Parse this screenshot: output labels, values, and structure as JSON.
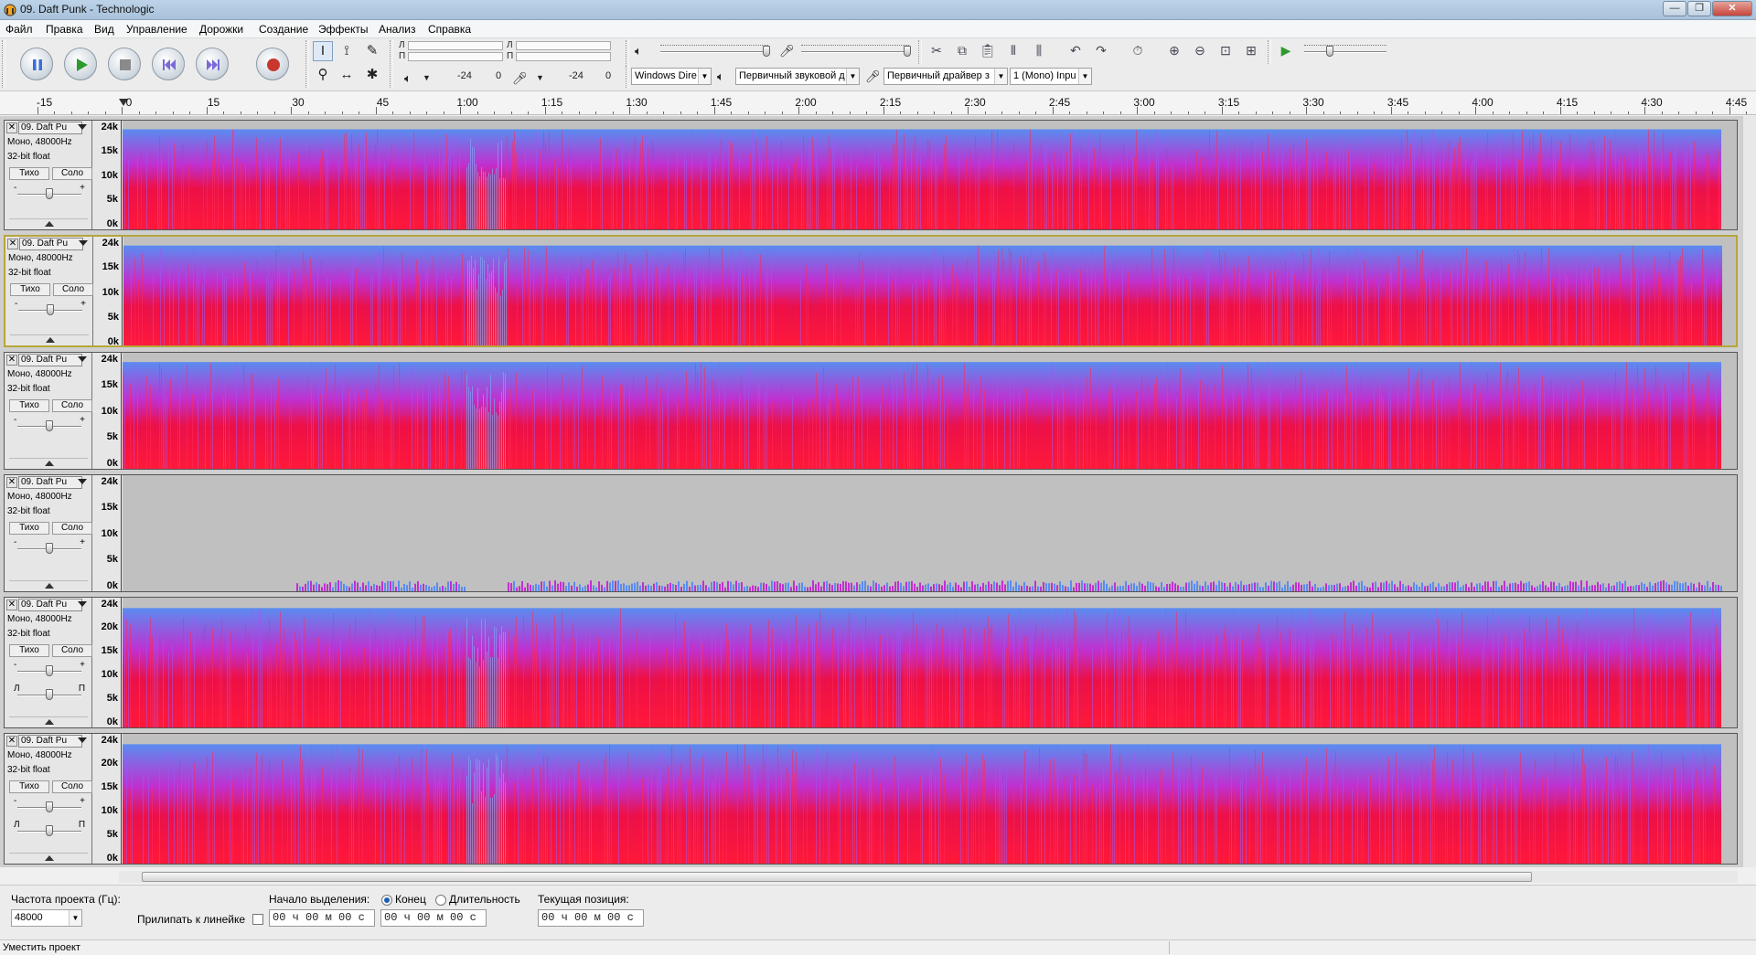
{
  "window": {
    "title": "09. Daft Punk - Technologic"
  },
  "menu": [
    "Файл",
    "Правка",
    "Вид",
    "Управление",
    "Дорожки",
    "Создание",
    "Эффекты",
    "Анализ",
    "Справка"
  ],
  "meters": {
    "left": "Л",
    "right": "П",
    "playback_db": "-24",
    "playback_zero": "0",
    "record_db": "-24",
    "record_zero": "0"
  },
  "devices": {
    "host": "Windows Dire",
    "output": "Первичный звуковой д",
    "input": "Первичный драйвер з",
    "channels": "1 (Mono) Inpu"
  },
  "ruler": [
    "-15",
    "0",
    "15",
    "30",
    "45",
    "1:00",
    "1:15",
    "1:30",
    "1:45",
    "2:00",
    "2:15",
    "2:30",
    "2:45",
    "3:00",
    "3:15",
    "3:30",
    "3:45",
    "4:00",
    "4:15",
    "4:30",
    "4:45"
  ],
  "track_common": {
    "name": "09. Daft Pu",
    "format": "Моно, 48000Hz",
    "bits": "32-bit float",
    "mute": "Тихо",
    "solo": "Соло",
    "gain_minus": "-",
    "gain_plus": "+",
    "pan_left": "Л",
    "pan_right": "П"
  },
  "tracks": [
    {
      "axis": [
        "24k",
        "15k",
        "10k",
        "5k",
        "0k"
      ],
      "spectrum": "full"
    },
    {
      "axis": [
        "24k",
        "15k",
        "10k",
        "5k",
        "0k"
      ],
      "spectrum": "full"
    },
    {
      "axis": [
        "24k",
        "15k",
        "10k",
        "5k",
        "0k"
      ],
      "spectrum": "full"
    },
    {
      "axis": [
        "24k",
        "15k",
        "10k",
        "5k",
        "0k"
      ],
      "spectrum": "sparse"
    },
    {
      "axis": [
        "24k",
        "20k",
        "15k",
        "10k",
        "5k",
        "0k"
      ],
      "spectrum": "full"
    },
    {
      "axis": [
        "24k",
        "20k",
        "15k",
        "10k",
        "5k",
        "0k"
      ],
      "spectrum": "full"
    }
  ],
  "selection": {
    "rate_label": "Частота проекта (Гц):",
    "rate_value": "48000",
    "snap_label": "Прилипать к линейке",
    "start_label": "Начало выделения:",
    "end_option": "Конец",
    "length_option": "Длительность",
    "start_value": "00 ч 00 м 00 с",
    "end_value": "00 ч 00 м 00 с",
    "pos_label": "Текущая позиция:",
    "pos_value": "00 ч 00 м 00 с"
  },
  "status": "Уместить проект",
  "colors": {
    "spec_bg": "#c0c0c0",
    "spec_red": "#e8104a",
    "spec_magenta": "#c030d0",
    "spec_blue": "#5a8cf0",
    "selected_track_border": "#b7a63a"
  }
}
